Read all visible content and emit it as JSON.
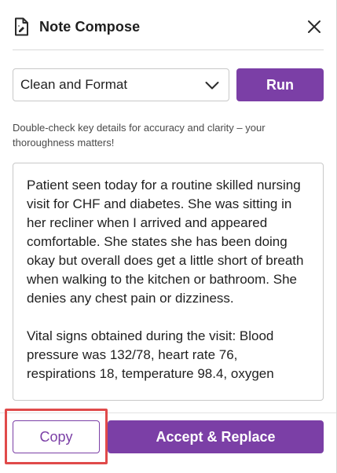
{
  "header": {
    "title": "Note Compose",
    "icon": "document-edit-icon",
    "close_icon": "close-icon"
  },
  "controls": {
    "mode_selected": "Clean and Format",
    "run_label": "Run"
  },
  "hint": "Double-check key details for accuracy and clarity – your thoroughness matters!",
  "note": {
    "paragraphs": [
      "Patient seen today for a routine skilled nursing visit for CHF and diabetes. She was sitting in her recliner when I arrived and appeared comfortable. She states she has been doing okay but overall does get a little short of breath when walking to the kitchen or bathroom. She denies any chest pain or dizziness.",
      "Vital signs obtained during the visit: Blood pressure was 132/78, heart rate 76, respirations 18, temperature 98.4, oxygen"
    ]
  },
  "footer": {
    "copy_label": "Copy",
    "accept_label": "Accept & Replace"
  },
  "colors": {
    "accent": "#7b3fa6",
    "highlight": "#e04a4a"
  }
}
